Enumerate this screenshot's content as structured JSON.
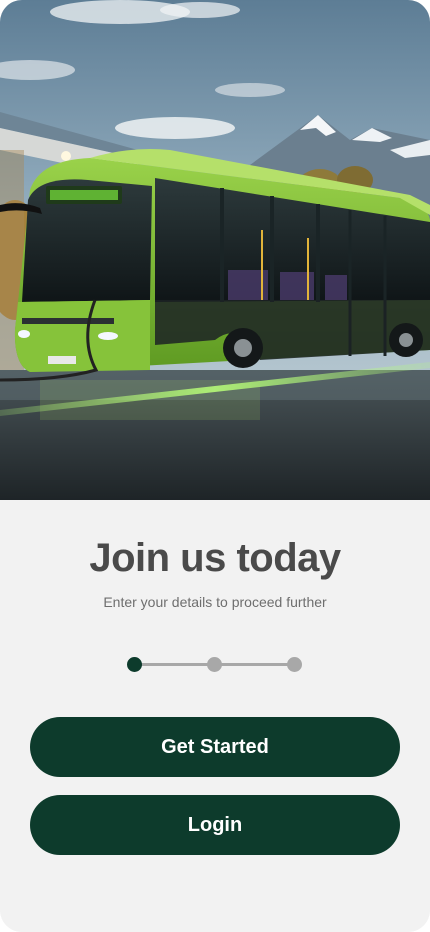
{
  "hero": {
    "image": "electric-bus-charging-station-photo"
  },
  "onboarding": {
    "title": "Join us today",
    "subtitle": "Enter your details to proceed further",
    "steps": {
      "total": 3,
      "current": 1
    }
  },
  "actions": {
    "get_started_label": "Get Started",
    "login_label": "Login"
  },
  "colors": {
    "primary": "#0d3b2c",
    "background": "#f2f2f2",
    "title": "#4a4a4a",
    "subtitle": "#6e6e6e",
    "step_inactive": "#a8a8a8",
    "bus_green": "#7fc133"
  }
}
